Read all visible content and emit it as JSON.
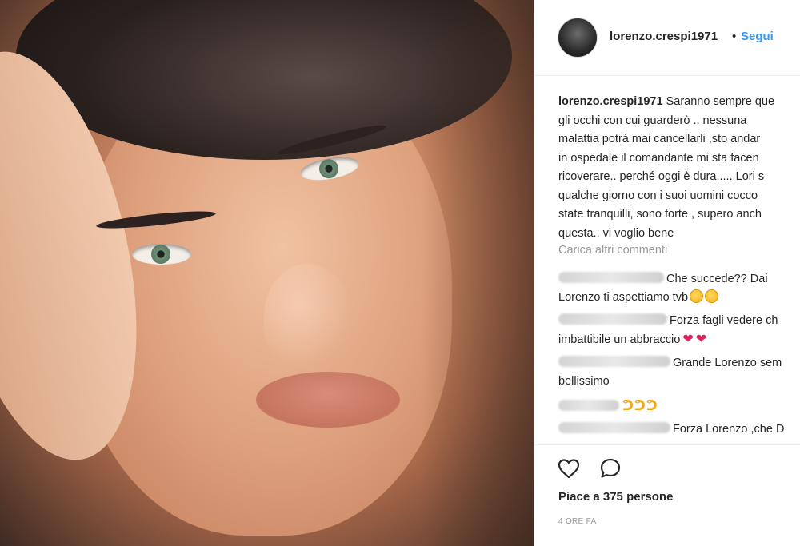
{
  "post": {
    "username": "lorenzo.crespi1971",
    "separator": "•",
    "follow_label": "Segui"
  },
  "caption": {
    "author": "lorenzo.crespi1971",
    "lines": [
      " Saranno sempre que",
      "gli occhi con cui guarderò .. nessuna",
      "malattia potrà mai cancellarli ,sto andar",
      "in ospedale il comandante mi sta facen",
      "ricoverare.. perché oggi è dura..... Lori s",
      "qualche giorno con i suoi uomini cocco",
      "state tranquilli, sono forte , supero anch",
      "questa.. vi voglio bene"
    ]
  },
  "load_more_label": "Carica altri commenti",
  "comments": [
    {
      "line1": "Che succede?? Dai",
      "line2": "Lorenzo ti aspettiamo tvb"
    },
    {
      "line1": "Forza fagli vedere ch",
      "line2": "imbattibile un abbraccio"
    },
    {
      "line1": "Grande Lorenzo sem",
      "line2": "bellissimo"
    },
    {
      "line1": ""
    },
    {
      "line1": "Forza Lorenzo ,che D"
    }
  ],
  "icons": {
    "like": "heart-outline-icon",
    "comment": "speech-bubble-icon"
  },
  "likes_text": "Piace a 375 persone",
  "timestamp": "4 ORE FA",
  "colors": {
    "link": "#3897f0",
    "muted": "#999999",
    "text": "#262626"
  }
}
